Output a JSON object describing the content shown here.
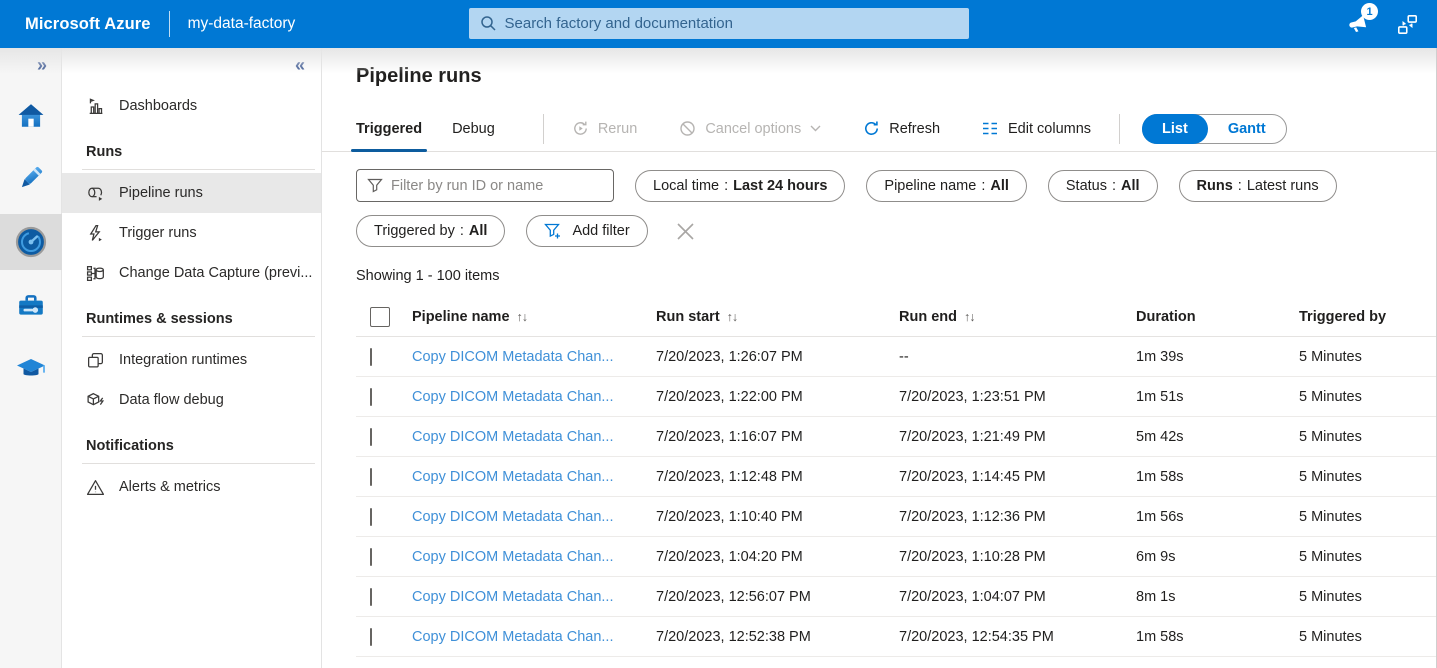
{
  "topbar": {
    "brand": "Microsoft Azure",
    "factory": "my-data-factory",
    "search_placeholder": "Search factory and documentation",
    "notification_count": "1"
  },
  "rail": {
    "expand_glyph": "»"
  },
  "sidebar": {
    "collapse_glyph": "«",
    "dashboards_label": "Dashboards",
    "sections": [
      {
        "header": "Runs",
        "items": [
          {
            "label": "Pipeline runs"
          },
          {
            "label": "Trigger runs"
          },
          {
            "label": "Change Data Capture (previ..."
          }
        ]
      },
      {
        "header": "Runtimes & sessions",
        "items": [
          {
            "label": "Integration runtimes"
          },
          {
            "label": "Data flow debug"
          }
        ]
      },
      {
        "header": "Notifications",
        "items": [
          {
            "label": "Alerts & metrics"
          }
        ]
      }
    ]
  },
  "main": {
    "title": "Pipeline runs",
    "tabs": [
      {
        "label": "Triggered"
      },
      {
        "label": "Debug"
      }
    ],
    "toolbar": {
      "rerun": "Rerun",
      "cancel": "Cancel options",
      "refresh": "Refresh",
      "edit_columns": "Edit columns",
      "list": "List",
      "gantt": "Gantt"
    },
    "filters": {
      "placeholder": "Filter by run ID or name",
      "separator": ":",
      "pills": [
        {
          "label": "Local time",
          "value": "Last 24 hours"
        },
        {
          "label": "Pipeline name",
          "value": "All"
        },
        {
          "label": "Status",
          "value": "All"
        },
        {
          "label": "Runs",
          "value": "Latest runs"
        },
        {
          "label": "Triggered by",
          "value": "All"
        }
      ],
      "add_filter": "Add filter"
    },
    "showing": "Showing 1 - 100 items",
    "table": {
      "sort_glyph": "↑↓",
      "columns": [
        "Pipeline name",
        "Run start",
        "Run end",
        "Duration",
        "Triggered by"
      ],
      "rows": [
        {
          "name": "Copy DICOM Metadata Chan...",
          "start": "7/20/2023, 1:26:07 PM",
          "end": "--",
          "duration": "1m 39s",
          "triggered_by": "5 Minutes"
        },
        {
          "name": "Copy DICOM Metadata Chan...",
          "start": "7/20/2023, 1:22:00 PM",
          "end": "7/20/2023, 1:23:51 PM",
          "duration": "1m 51s",
          "triggered_by": "5 Minutes"
        },
        {
          "name": "Copy DICOM Metadata Chan...",
          "start": "7/20/2023, 1:16:07 PM",
          "end": "7/20/2023, 1:21:49 PM",
          "duration": "5m 42s",
          "triggered_by": "5 Minutes"
        },
        {
          "name": "Copy DICOM Metadata Chan...",
          "start": "7/20/2023, 1:12:48 PM",
          "end": "7/20/2023, 1:14:45 PM",
          "duration": "1m 58s",
          "triggered_by": "5 Minutes"
        },
        {
          "name": "Copy DICOM Metadata Chan...",
          "start": "7/20/2023, 1:10:40 PM",
          "end": "7/20/2023, 1:12:36 PM",
          "duration": "1m 56s",
          "triggered_by": "5 Minutes"
        },
        {
          "name": "Copy DICOM Metadata Chan...",
          "start": "7/20/2023, 1:04:20 PM",
          "end": "7/20/2023, 1:10:28 PM",
          "duration": "6m 9s",
          "triggered_by": "5 Minutes"
        },
        {
          "name": "Copy DICOM Metadata Chan...",
          "start": "7/20/2023, 12:56:07 PM",
          "end": "7/20/2023, 1:04:07 PM",
          "duration": "8m 1s",
          "triggered_by": "5 Minutes"
        },
        {
          "name": "Copy DICOM Metadata Chan...",
          "start": "7/20/2023, 12:52:38 PM",
          "end": "7/20/2023, 12:54:35 PM",
          "duration": "1m 58s",
          "triggered_by": "5 Minutes"
        }
      ]
    }
  },
  "colors": {
    "brand_blue": "#0078d4",
    "topbar_search_bg": "#b3d6f2",
    "link_blue": "#3f90d8",
    "active_tab_underline": "#0d5c9e",
    "selected_nav_bg": "#e8e8e8",
    "disabled_gray": "#b6b4b2"
  }
}
